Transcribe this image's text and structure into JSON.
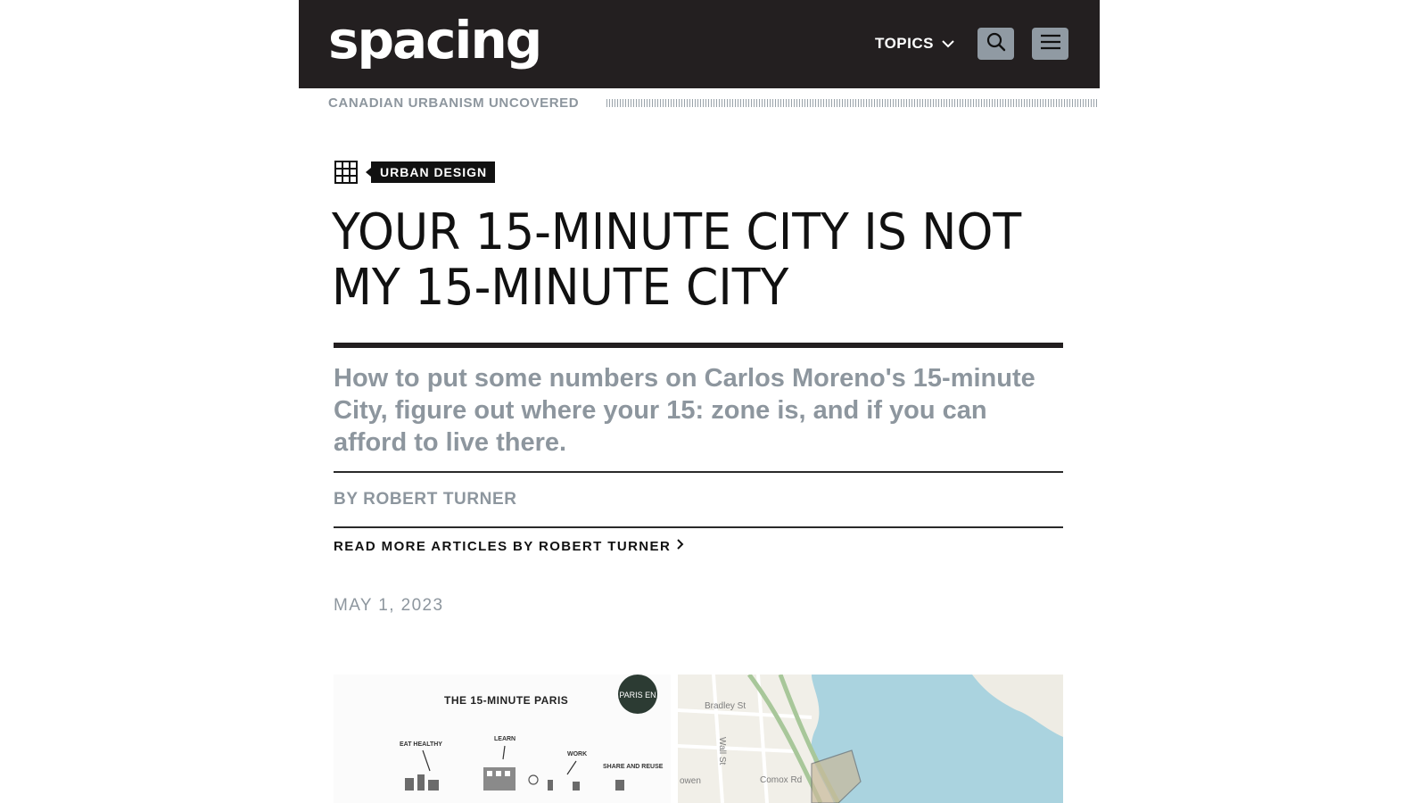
{
  "header": {
    "logo_text": "spacing",
    "topics_label": "TOPICS",
    "icons": [
      "chevron-down-icon",
      "search-icon",
      "menu-icon"
    ],
    "tagline": "CANADIAN URBANISM UNCOVERED",
    "colors": {
      "bar": "#231f20",
      "button": "#909aa3",
      "muted_text": "#8d969e"
    }
  },
  "article": {
    "category_icon": "grid-icon",
    "category": "URBAN DESIGN",
    "title_line1": "YOUR 15-MINUTE CITY IS NOT",
    "title_line2": "MY 15-MINUTE CITY",
    "deck_line1": "How to put some numbers on Carlos Moreno's 15-minute",
    "deck_line2": "City, figure out where your 15: zone is, and if you can",
    "deck_line3": "afford to live there.",
    "byline": "BY ROBERT TURNER",
    "read_more": "READ MORE ARTICLES BY ROBERT TURNER",
    "date": "MAY 1, 2023"
  },
  "figure_left": {
    "title": "THE 15-MINUTE PARIS",
    "badge": "PARIS EN",
    "labels": [
      "EAT HEALTHY",
      "LEARN",
      "WORK",
      "SHARE AND REUSE"
    ]
  },
  "figure_right": {
    "streets": [
      "Bradley St",
      "Wall St",
      "Comox Rd",
      "owen"
    ],
    "water_color": "#aad3df"
  }
}
